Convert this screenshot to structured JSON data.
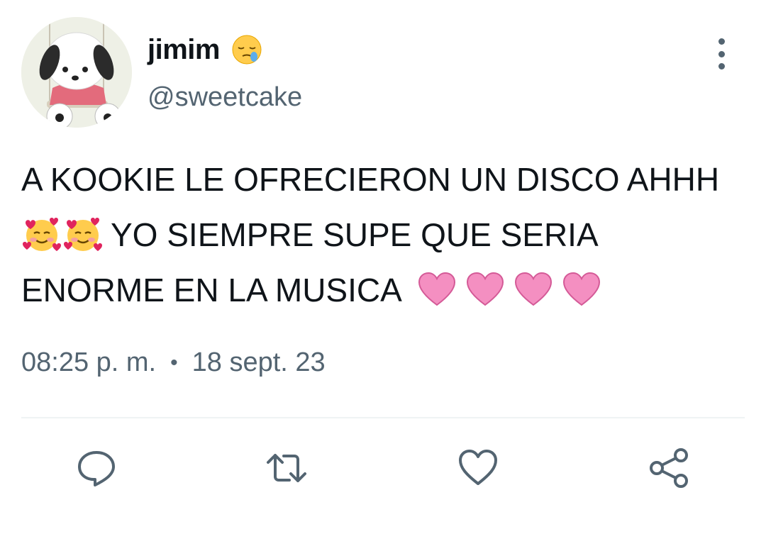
{
  "tweet": {
    "author": {
      "display_name": "jimim",
      "name_emoji": "sleepy-face-emoji",
      "handle": "@sweetcake",
      "avatar": "pochacco-avatar"
    },
    "text_lines": [
      "A KOOKIE LE OFRECIERON UN DISCO AHHH",
      "YO SIEMPRE SUPE QUE SERIA",
      "ENORME EN LA MUSICA"
    ],
    "emojis": {
      "line2": [
        "smiling-face-with-hearts-emoji",
        "smiling-face-with-hearts-emoji"
      ],
      "line3": [
        "pink-heart-emoji",
        "pink-heart-emoji",
        "pink-heart-emoji",
        "pink-heart-emoji"
      ]
    },
    "time": "08:25 p. m.",
    "separator": "•",
    "date": "18 sept. 23"
  },
  "actions": [
    "reply-icon",
    "retweet-icon",
    "like-icon",
    "share-icon"
  ],
  "colors": {
    "text": "#0f1419",
    "secondary": "#536471",
    "divider": "#eff3f4",
    "heart_pink": "#f48fc1"
  }
}
